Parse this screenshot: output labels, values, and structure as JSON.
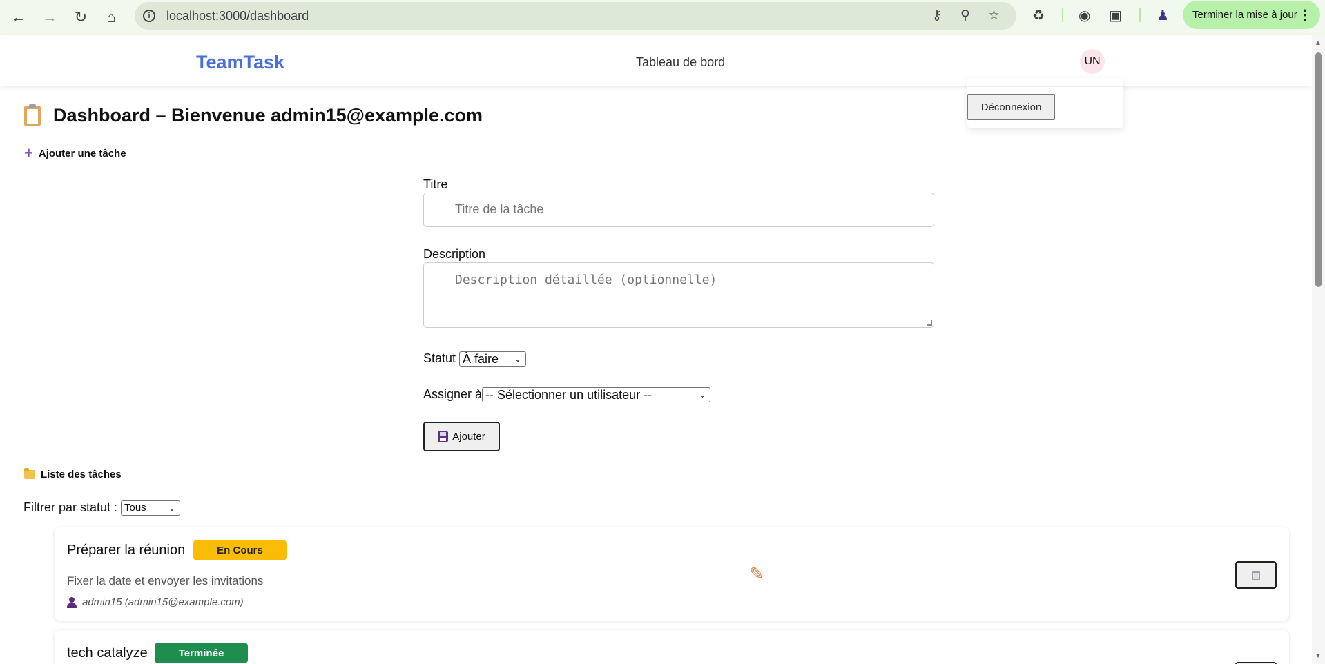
{
  "browser": {
    "url": "localhost:3000/dashboard",
    "update_label": "Terminer la mise à jour"
  },
  "header": {
    "logo": "TeamTask",
    "nav_title": "Tableau de bord",
    "avatar_initials": "UN",
    "logout_label": "Déconnexion"
  },
  "page": {
    "title": "Dashboard – Bienvenue admin15@example.com",
    "add_task_label": "Ajouter une tâche"
  },
  "form": {
    "title_label": "Titre",
    "title_placeholder": "Titre de la tâche",
    "description_label": "Description",
    "description_placeholder": "Description détaillée (optionnelle)",
    "status_label": "Statut",
    "status_value": "À faire",
    "assign_label": "Assigner à",
    "assign_value": "-- Sélectionner un utilisateur --",
    "submit_label": "Ajouter"
  },
  "list": {
    "title": "Liste des tâches",
    "filter_label": "Filtrer par statut :",
    "filter_value": "Tous",
    "tasks": [
      {
        "title": "Préparer la réunion",
        "status": "En Cours",
        "status_color": "#fbbc05",
        "description": "Fixer la date et envoyer les invitations",
        "assignee": "admin15 (admin15@example.com)"
      },
      {
        "title": "tech catalyze",
        "status": "Terminée",
        "status_color": "#1e8e4e"
      }
    ]
  },
  "colors": {
    "brand": "#4a6fd8",
    "in_progress": "#fbbc05",
    "done": "#1e8e4e",
    "edit_icon": "#e8753a"
  }
}
